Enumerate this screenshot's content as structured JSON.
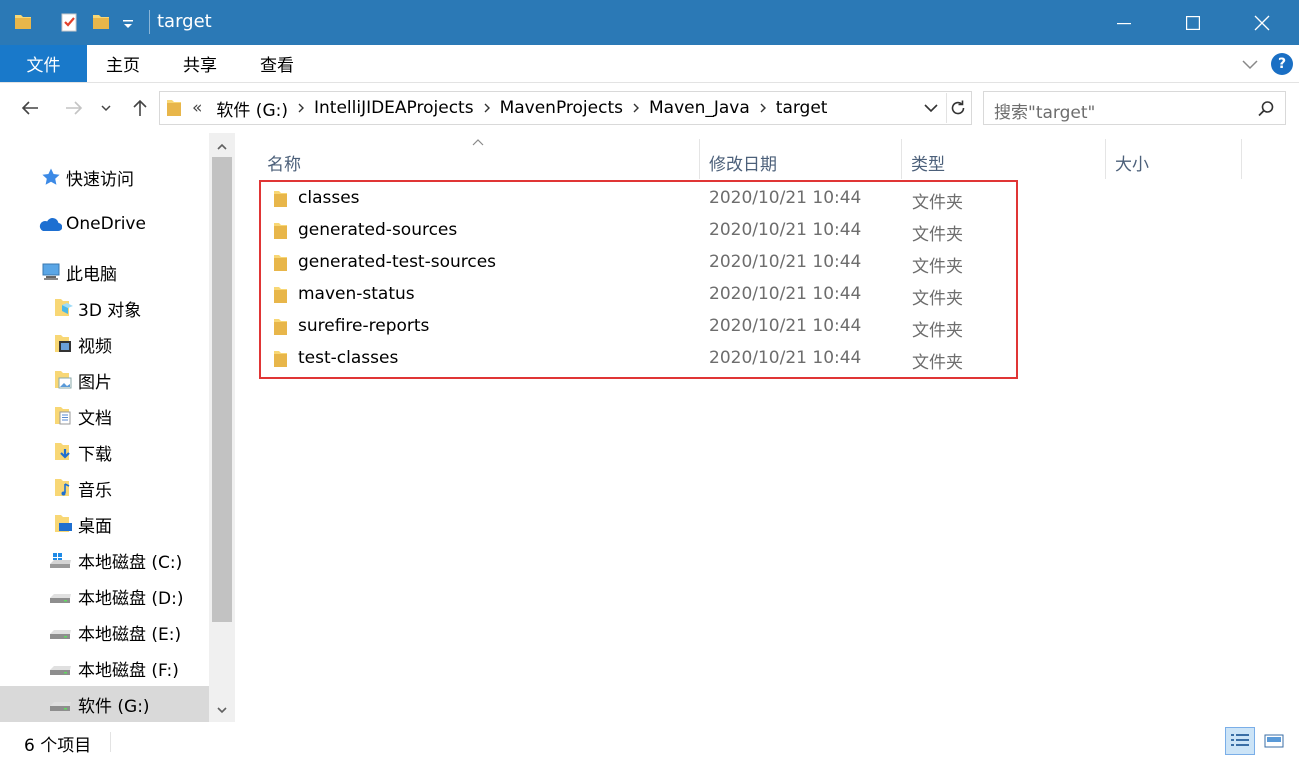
{
  "window": {
    "title": "target",
    "accent_color": "#2b79b6"
  },
  "ribbon": {
    "tabs": [
      "文件",
      "主页",
      "共享",
      "查看"
    ],
    "help_label": "?"
  },
  "address": {
    "overflow": "«",
    "crumbs": [
      "软件 (G:)",
      "IntelliJIDEAProjects",
      "MavenProjects",
      "Maven_Java",
      "target"
    ],
    "search_placeholder": "搜索\"target\""
  },
  "nav": {
    "items": [
      {
        "label": "快速访问",
        "icon": "star-icon"
      },
      {
        "label": "OneDrive",
        "icon": "cloud-icon"
      },
      {
        "label": "此电脑",
        "icon": "computer-icon"
      },
      {
        "label": "3D 对象",
        "icon": "3d-objects-folder-icon"
      },
      {
        "label": "视频",
        "icon": "videos-folder-icon"
      },
      {
        "label": "图片",
        "icon": "pictures-folder-icon"
      },
      {
        "label": "文档",
        "icon": "documents-folder-icon"
      },
      {
        "label": "下载",
        "icon": "downloads-folder-icon"
      },
      {
        "label": "音乐",
        "icon": "music-folder-icon"
      },
      {
        "label": "桌面",
        "icon": "desktop-folder-icon"
      },
      {
        "label": "本地磁盘 (C:)",
        "icon": "windows-drive-icon"
      },
      {
        "label": "本地磁盘 (D:)",
        "icon": "drive-icon"
      },
      {
        "label": "本地磁盘 (E:)",
        "icon": "drive-icon"
      },
      {
        "label": "本地磁盘 (F:)",
        "icon": "drive-icon"
      },
      {
        "label": "软件 (G:)",
        "icon": "drive-icon"
      }
    ],
    "selected": "软件 (G:)"
  },
  "columns": [
    "名称",
    "修改日期",
    "类型",
    "大小"
  ],
  "files": [
    {
      "name": "classes",
      "date": "2020/10/21 10:44",
      "type": "文件夹"
    },
    {
      "name": "generated-sources",
      "date": "2020/10/21 10:44",
      "type": "文件夹"
    },
    {
      "name": "generated-test-sources",
      "date": "2020/10/21 10:44",
      "type": "文件夹"
    },
    {
      "name": "maven-status",
      "date": "2020/10/21 10:44",
      "type": "文件夹"
    },
    {
      "name": "surefire-reports",
      "date": "2020/10/21 10:44",
      "type": "文件夹"
    },
    {
      "name": "test-classes",
      "date": "2020/10/21 10:44",
      "type": "文件夹"
    }
  ],
  "status": {
    "item_count": "6 个项目"
  }
}
